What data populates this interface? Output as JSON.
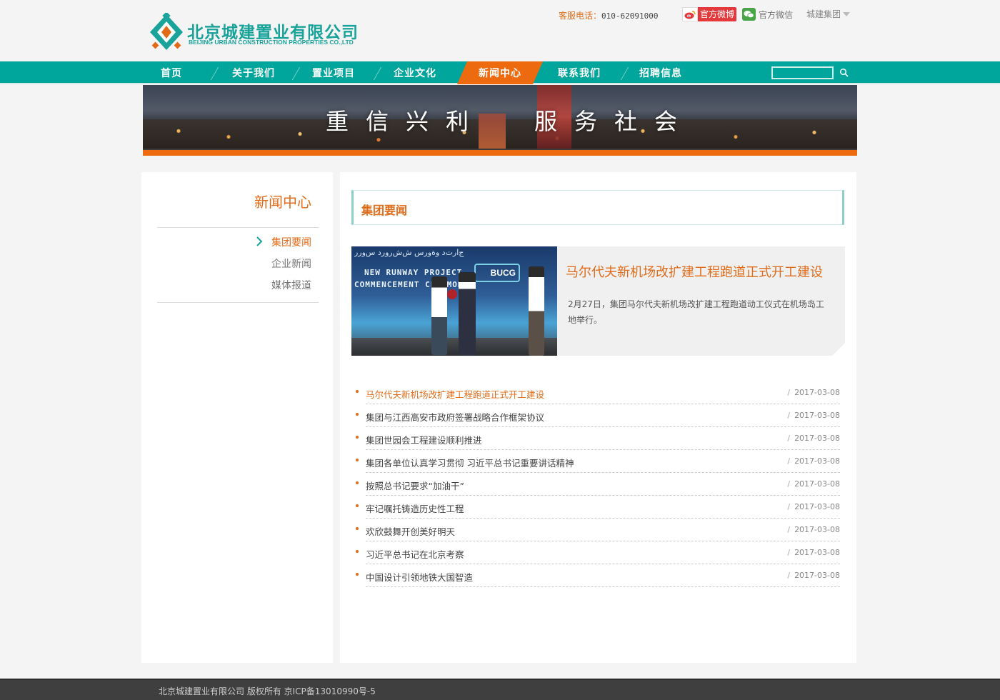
{
  "brand": {
    "name_cn": "北京城建置业有限公司",
    "name_en": "BEIJING URBAN CONSTRUCTION PROPERTIES CO.,LTD",
    "primary_color": "#00a69c",
    "accent_color": "#ee6a0f"
  },
  "top_links": {
    "hotline_label": "客服电话：",
    "hotline_number": "010-62091000",
    "weibo_label": "官方微博",
    "wechat_label": "官方微信",
    "group_label": "城建集团"
  },
  "nav": {
    "items": [
      {
        "label": "首页"
      },
      {
        "label": "关于我们"
      },
      {
        "label": "置业项目"
      },
      {
        "label": "企业文化"
      },
      {
        "label": "新闻中心"
      },
      {
        "label": "联系我们"
      },
      {
        "label": "招聘信息"
      }
    ],
    "active_index": 4,
    "search_placeholder": ""
  },
  "banner": {
    "slogan_left": "重信兴利",
    "slogan_right": "服务社会"
  },
  "sidebar": {
    "title": "新闻中心",
    "items": [
      {
        "label": "集团要闻",
        "active": true
      },
      {
        "label": "企业新闻",
        "active": false
      },
      {
        "label": "媒体报道",
        "active": false
      }
    ]
  },
  "main": {
    "section_title": "集团要闻",
    "feature": {
      "image_text_line1": "NEW RUNWAY PROJECT",
      "image_text_line2": "COMMENCEMENT CEREMONY",
      "image_logo": "BUCG",
      "title": "马尔代夫新机场改扩建工程跑道正式开工建设",
      "description": "2月27日，集团马尔代夫新机场改扩建工程跑道动工仪式在机场岛工地举行。"
    },
    "news": [
      {
        "title": "马尔代夫新机场改扩建工程跑道正式开工建设",
        "date": "2017-03-08",
        "highlight": true
      },
      {
        "title": "集团与江西高安市政府签署战略合作框架协议",
        "date": "2017-03-08",
        "highlight": false
      },
      {
        "title": "集团世园会工程建设顺利推进",
        "date": "2017-03-08",
        "highlight": false
      },
      {
        "title": "集团各单位认真学习贯彻 习近平总书记重要讲话精神",
        "date": "2017-03-08",
        "highlight": false
      },
      {
        "title": "按照总书记要求“加油干”",
        "date": "2017-03-08",
        "highlight": false
      },
      {
        "title": "牢记嘱托铸造历史性工程",
        "date": "2017-03-08",
        "highlight": false
      },
      {
        "title": "欢欣鼓舞开创美好明天",
        "date": "2017-03-08",
        "highlight": false
      },
      {
        "title": "习近平总书记在北京考察",
        "date": "2017-03-08",
        "highlight": false
      },
      {
        "title": "中国设计引领地铁大国智造",
        "date": "2017-03-08",
        "highlight": false
      }
    ]
  },
  "footer": {
    "text": "北京城建置业有限公司 版权所有  京ICP备13010990号-5"
  }
}
